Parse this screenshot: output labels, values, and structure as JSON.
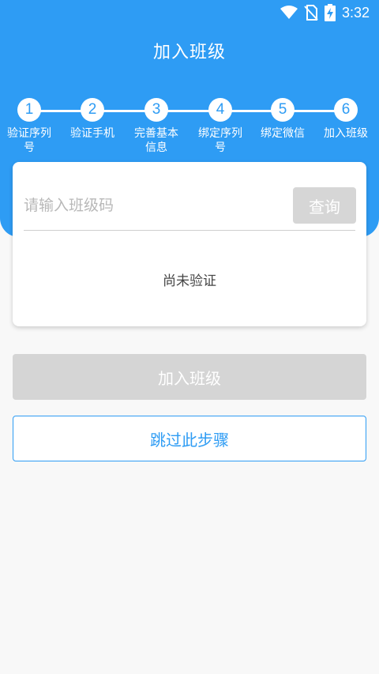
{
  "status_bar": {
    "time": "3:32",
    "icons": [
      "wifi-icon",
      "no-sim-icon",
      "battery-charging-icon"
    ]
  },
  "header": {
    "title": "加入班级"
  },
  "stepper": {
    "steps": [
      {
        "number": "1",
        "label": "验证序列号"
      },
      {
        "number": "2",
        "label": "验证手机"
      },
      {
        "number": "3",
        "label": "完善基本信息"
      },
      {
        "number": "4",
        "label": "绑定序列号"
      },
      {
        "number": "5",
        "label": "绑定微信"
      },
      {
        "number": "6",
        "label": "加入班级"
      }
    ]
  },
  "card": {
    "input_placeholder": "请输入班级码",
    "input_value": "",
    "query_label": "查询",
    "status_text": "尚未验证"
  },
  "actions": {
    "join_label": "加入班级",
    "skip_label": "跳过此步骤"
  },
  "colors": {
    "primary": "#2e9cf4",
    "disabled": "#d5d5d5",
    "background": "#f8f8f8"
  }
}
